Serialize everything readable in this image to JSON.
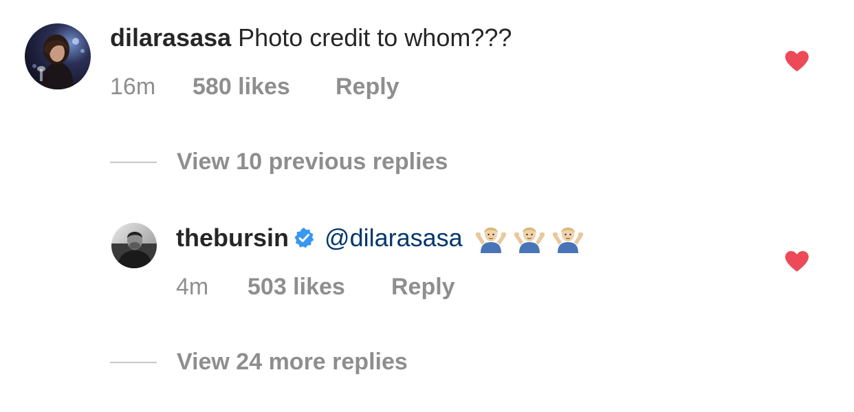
{
  "comments": [
    {
      "username": "dilarasasa",
      "text": "Photo credit to whom???",
      "time": "16m",
      "likes": "580 likes",
      "reply_label": "Reply",
      "liked": true
    },
    {
      "username": "thebursin",
      "verified": true,
      "mention": "@dilarasasa",
      "emoji": "person-shrugging-emoji",
      "emoji_count": 3,
      "time": "4m",
      "likes": "503 likes",
      "reply_label": "Reply",
      "liked": true
    }
  ],
  "reply_threads": [
    {
      "label": "View 10 previous replies"
    },
    {
      "label": "View 24 more replies"
    }
  ],
  "colors": {
    "text": "#262626",
    "meta": "#8e8e8e",
    "mention": "#00376b",
    "heart": "#ed4956",
    "verified": "#3897f0"
  }
}
